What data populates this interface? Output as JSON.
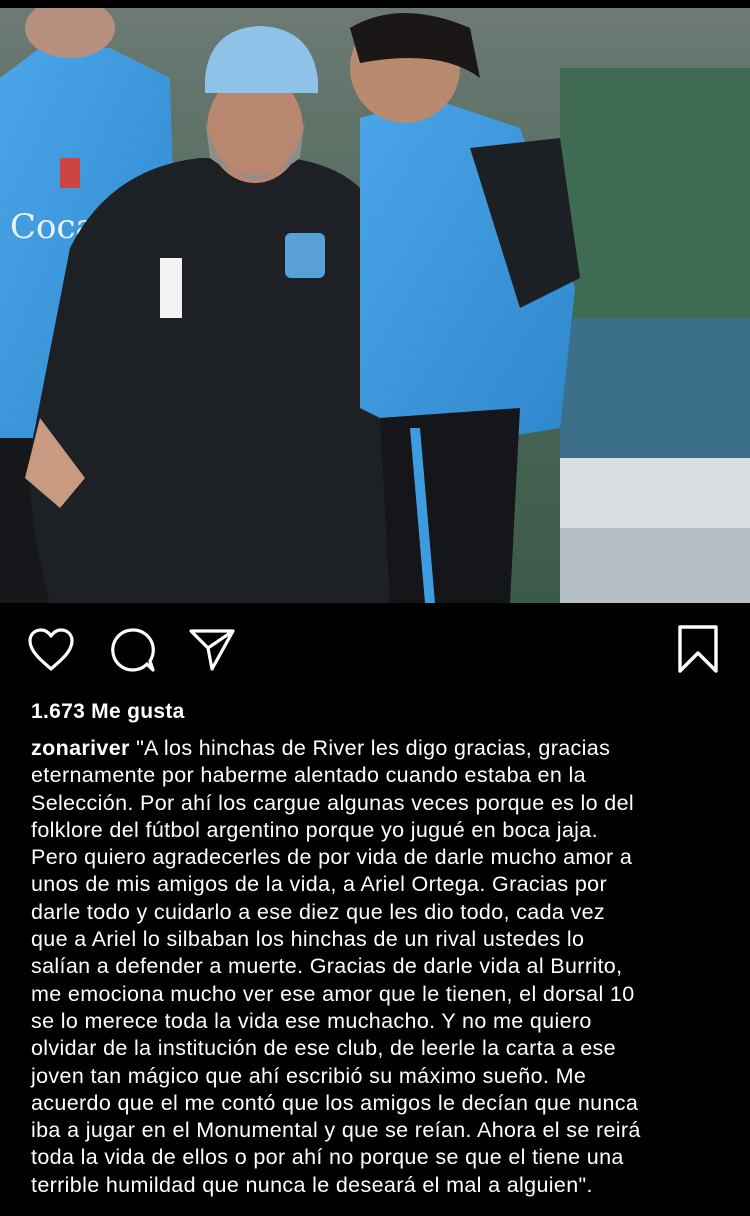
{
  "post": {
    "likes_text": "1.673 Me gusta",
    "username": "zonariver",
    "caption_lines": [
      " \"A los hinchas de River les digo gracias, gracias",
      "eternamente por haberme alentado cuando estaba en la",
      "Selección. Por ahí los cargue algunas veces porque es lo del",
      "folklore del fútbol argentino porque yo jugué en boca jaja.",
      "Pero quiero agradecerles de por vida de darle mucho amor a",
      "unos de mis amigos de la vida, a Ariel Ortega. Gracias por",
      "darle todo y cuidarlo a ese diez que les dio todo, cada vez",
      "que a Ariel lo silbaban los hinchas de un rival ustedes lo",
      "salían a defender a muerte. Gracias de darle vida al Burrito,",
      "me emociona mucho ver ese amor que le tienen, el dorsal 10",
      "se lo merece toda la vida ese muchacho. Y no me quiero",
      "olvidar de la institución de ese club, de leerle la carta a ese",
      "joven tan mágico que ahí escribió su máximo sueño. Me",
      "acuerdo que el me contó que los amigos le decían que nunca",
      "iba a jugar en el Monumental y que se reían. Ahora el se reirá",
      "toda la vida de ellos o por ahí no porque se que el tiene una",
      "terrible humildad que nunca le deseará el mal a alguien\"."
    ]
  },
  "icons": {
    "like": "heart-outline-icon",
    "comment": "speech-bubble-icon",
    "share": "paper-plane-icon",
    "save": "bookmark-outline-icon"
  },
  "colors": {
    "background": "#000000",
    "text": "#ffffff",
    "bib_blue": "#3f9be0",
    "jacket": "#1c1f24"
  }
}
